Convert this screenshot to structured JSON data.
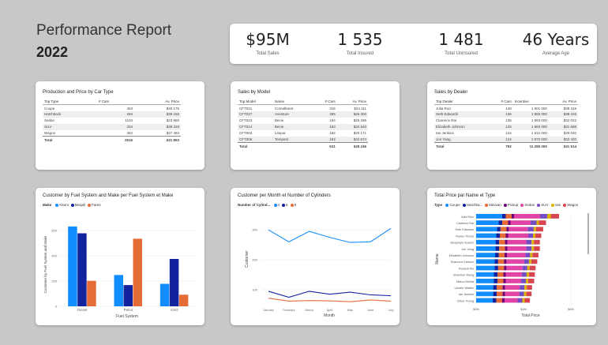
{
  "header": {
    "title": "Performance Report",
    "year": "2022"
  },
  "kpis": [
    {
      "value": "$95M",
      "label": "Total Sales"
    },
    {
      "value": "1 535",
      "label": "Total Insured"
    },
    {
      "value": "1 481",
      "label": "Total Uninsured"
    },
    {
      "value": "46 Years",
      "label": "Average Age"
    }
  ],
  "table1": {
    "title": "Production and Price by Car Type",
    "columns": [
      "Top Type",
      "# Cars",
      "Av. Price"
    ],
    "rows": [
      [
        "Coupe",
        "453",
        "$40 175"
      ],
      [
        "Hatchback",
        "284",
        "$38 156"
      ],
      [
        "Sedan",
        "1104",
        "$23 860"
      ],
      [
        "SUV",
        "334",
        "$38 318"
      ],
      [
        "Wagon",
        "362",
        "$27 453"
      ]
    ],
    "total": [
      "Total",
      "2515",
      "$31 853"
    ]
  },
  "table2": {
    "title": "Sales by Model",
    "columns": [
      "Top Model",
      "Name",
      "# Cars",
      "Av. Price"
    ],
    "rows": [
      [
        "CFT021",
        "Comalbaret",
        "315",
        "$24 111"
      ],
      [
        "CFT027",
        "Aventure",
        "385",
        "$26 300"
      ],
      [
        "CFT023",
        "Becie",
        "184",
        "$25 286"
      ],
      [
        "CFT014",
        "Becie",
        "183",
        "$34 540"
      ],
      [
        "CFT003",
        "Litopia",
        "182",
        "$20 171"
      ],
      [
        "CFT006",
        "Tempest",
        "182",
        "$42 674"
      ]
    ],
    "total": [
      "Total",
      "",
      "631",
      "$28 246"
    ]
  },
  "table3": {
    "title": "Sales by Dealer",
    "columns": [
      "Top Dealer",
      "# Cars",
      "Incentive",
      "Av. Price"
    ],
    "rows": [
      [
        "Julia Ruiz",
        "148",
        "1 901 000",
        "$39 318"
      ],
      [
        "Seth Edwards",
        "136",
        "1 866 000",
        "$38 315"
      ],
      [
        "Clarence Rai",
        "135",
        "1 883 000",
        "$32 023"
      ],
      [
        "Elizabeth Johnson",
        "125",
        "1 860 000",
        "$31 688"
      ],
      [
        "Ian Jenkins",
        "124",
        "1 912 000",
        "$29 040"
      ],
      [
        "Jon Yang",
        "124",
        "1 872 000",
        "$32 420"
      ]
    ],
    "total": [
      "Total",
      "792",
      "11 295 000",
      "$31 514"
    ]
  },
  "chart1": {
    "title": "Customer by Fuel System and Make per Fuel System et Make",
    "legend_title": "Make",
    "ylabel": "Customer by Fuel System and Make",
    "xlabel": "Fuel System",
    "yticks": [
      "0",
      "200",
      "400",
      "600"
    ]
  },
  "chart2": {
    "title": "Customer per Month et Number of Cylinders",
    "legend_title": "Number of Cylind...",
    "ylabel": "Customer",
    "xlabel": "Month",
    "yticks": [
      "100",
      "200",
      "300"
    ]
  },
  "chart3": {
    "title": "Total Price par Name et Type",
    "legend_title": "Type",
    "ylabel": "Name",
    "xlabel": "Total Price",
    "xticks": [
      "$0M",
      "$2M",
      "$4M"
    ]
  },
  "colors": {
    "blue": "#118dff",
    "navy": "#12239e",
    "orange": "#e66c37",
    "purple": "#6b007b",
    "pink": "#e044a7",
    "violet": "#744ec2",
    "yellow": "#d9b300",
    "red": "#d64550"
  },
  "chart_data": [
    {
      "type": "bar",
      "categories": [
        "Diesel",
        "Petrol",
        "CNG"
      ],
      "series": [
        {
          "name": "Alsuni",
          "color": "#118dff",
          "values": [
            632,
            248,
            178
          ]
        },
        {
          "name": "Meqali",
          "color": "#12239e",
          "values": [
            578,
            168,
            375
          ]
        },
        {
          "name": "Fares",
          "color": "#e66c37",
          "values": [
            202,
            535,
            92
          ]
        }
      ],
      "ylim": [
        0,
        700
      ]
    },
    {
      "type": "line",
      "categories": [
        "January",
        "February",
        "March",
        "April",
        "May",
        "June",
        "July"
      ],
      "series": [
        {
          "name": "4",
          "color": "#118dff",
          "values": [
            300,
            260,
            295,
            275,
            258,
            260,
            305
          ]
        },
        {
          "name": "6",
          "color": "#12239e",
          "values": [
            95,
            75,
            95,
            85,
            92,
            83,
            80
          ]
        },
        {
          "name": "8",
          "color": "#e66c37",
          "values": [
            72,
            62,
            64,
            63,
            60,
            66,
            62
          ]
        }
      ],
      "ylim": [
        50,
        340
      ]
    },
    {
      "type": "bar",
      "orientation": "horizontal",
      "stacked": true,
      "categories": [
        "Julia Ruiz",
        "Clarence Rai",
        "Seth Edwards",
        "Ruben Torres",
        "Jacquelyn Suarez",
        "Jon Yang",
        "Elizabeth Johnson",
        "Shannon Carlson",
        "Russell Xie",
        "Shannon Wang",
        "Marco Mehta",
        "Lauren Walker",
        "Ian Jenkins",
        "Chloe Young"
      ],
      "series": [
        {
          "name": "Coupe",
          "color": "#118dff",
          "values": [
            1.1,
            0.95,
            0.88,
            0.85,
            0.82,
            0.82,
            0.8,
            0.78,
            0.78,
            0.75,
            0.75,
            0.72,
            0.72,
            0.7
          ]
        },
        {
          "name": "Hatchba...",
          "color": "#12239e",
          "values": [
            0.15,
            0.15,
            0.15,
            0.15,
            0.15,
            0.15,
            0.15,
            0.15,
            0.15,
            0.15,
            0.15,
            0.15,
            0.15,
            0.15
          ]
        },
        {
          "name": "Minivan",
          "color": "#e66c37",
          "values": [
            0.25,
            0.25,
            0.25,
            0.25,
            0.25,
            0.25,
            0.25,
            0.25,
            0.25,
            0.25,
            0.25,
            0.25,
            0.25,
            0.25
          ]
        },
        {
          "name": "Pickup",
          "color": "#6b007b",
          "values": [
            0.1,
            0.1,
            0.1,
            0.1,
            0.1,
            0.1,
            0.1,
            0.1,
            0.1,
            0.1,
            0.1,
            0.1,
            0.1,
            0.1
          ]
        },
        {
          "name": "Sedan",
          "color": "#e044a7",
          "values": [
            1.1,
            0.85,
            0.8,
            0.85,
            0.8,
            0.8,
            0.78,
            0.75,
            0.68,
            0.68,
            0.65,
            0.62,
            0.6,
            0.55
          ]
        },
        {
          "name": "SUV",
          "color": "#744ec2",
          "values": [
            0.3,
            0.25,
            0.25,
            0.2,
            0.22,
            0.22,
            0.2,
            0.2,
            0.2,
            0.2,
            0.2,
            0.2,
            0.2,
            0.2
          ]
        },
        {
          "name": "Van",
          "color": "#d9b300",
          "values": [
            0.15,
            0.1,
            0.1,
            0.1,
            0.1,
            0.1,
            0.1,
            0.1,
            0.1,
            0.1,
            0.1,
            0.1,
            0.1,
            0.1
          ]
        },
        {
          "name": "Wagon",
          "color": "#d64550",
          "values": [
            0.35,
            0.3,
            0.3,
            0.25,
            0.25,
            0.25,
            0.25,
            0.25,
            0.25,
            0.25,
            0.25,
            0.22,
            0.22,
            0.22
          ]
        }
      ],
      "xlim": [
        0,
        4.5
      ]
    }
  ]
}
